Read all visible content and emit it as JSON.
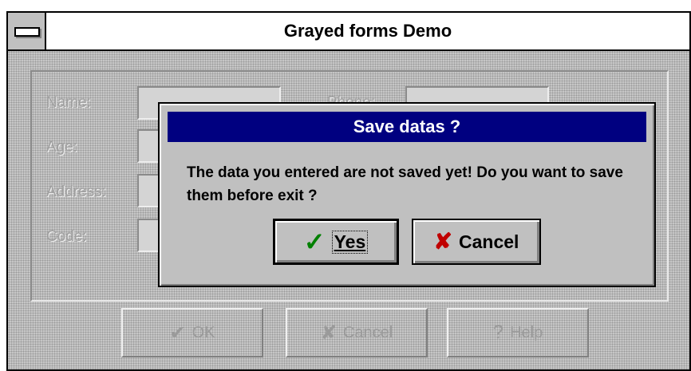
{
  "window": {
    "title": "Grayed forms Demo"
  },
  "form": {
    "labels": {
      "name": "Name:",
      "phone": "Phone:",
      "age": "Age:",
      "address": "Address:",
      "code": "Code:"
    }
  },
  "buttons": {
    "ok": {
      "label": "OK",
      "icon": "check-icon"
    },
    "cancel": {
      "label": "Cancel",
      "icon": "x-icon"
    },
    "help": {
      "label": "Help",
      "icon": "question-icon"
    }
  },
  "dialog": {
    "title": "Save datas ?",
    "message": "The data  you entered are not saved yet! Do you want to save them before exit ?",
    "yes": {
      "label": "Yes",
      "icon": "check-icon",
      "icon_color": "#008000"
    },
    "cancel": {
      "label": "Cancel",
      "icon": "x-icon",
      "icon_color": "#c00000"
    }
  },
  "colors": {
    "dialog_title_bg": "#000080",
    "face": "#c0c0c0"
  }
}
